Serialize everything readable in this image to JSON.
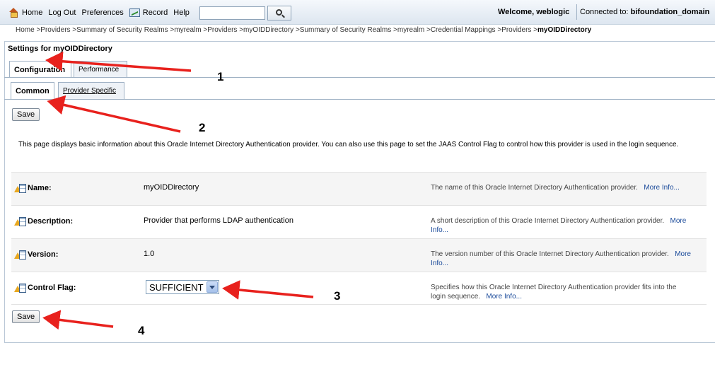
{
  "toolbar": {
    "home": "Home",
    "logout": "Log Out",
    "preferences": "Preferences",
    "record": "Record",
    "help": "Help",
    "search_value": "",
    "welcome": "Welcome, weblogic",
    "connected_label": "Connected to:",
    "connected_domain": "bifoundation_domain"
  },
  "breadcrumb": {
    "path": "Home >Providers >Summary of Security Realms >myrealm >Providers >myOIDDirectory >Summary of Security Realms >myrealm >Credential Mappings >Providers >",
    "current": "myOIDDirectory"
  },
  "panel": {
    "title": "Settings for myOIDDirectory",
    "tabs": [
      "Configuration",
      "Performance"
    ],
    "subtabs": [
      "Common",
      "Provider Specific"
    ],
    "save_label": "Save",
    "description": "This page displays basic information about this Oracle Internet Directory Authentication provider. You can also use this page to set the JAAS Control Flag to control how this provider is used in the login sequence."
  },
  "fields": [
    {
      "label": "Name:",
      "value": "myOIDDirectory",
      "help": "The name of this Oracle Internet Directory Authentication provider.",
      "more": "More Info..."
    },
    {
      "label": "Description:",
      "value": "Provider that performs LDAP authentication",
      "help": "A short description of this Oracle Internet Directory Authentication provider.",
      "more": "More Info..."
    },
    {
      "label": "Version:",
      "value": "1.0",
      "help": "The version number of this Oracle Internet Directory Authentication provider.",
      "more": "More Info..."
    },
    {
      "label": "Control Flag:",
      "value": "SUFFICIENT",
      "help": "Specifies how this Oracle Internet Directory Authentication provider fits into the login sequence.",
      "more": "More Info..."
    }
  ],
  "annotations": [
    "1",
    "2",
    "3",
    "4"
  ],
  "colors": {
    "arrow": "#e8211d",
    "link": "#1a4a9a"
  }
}
